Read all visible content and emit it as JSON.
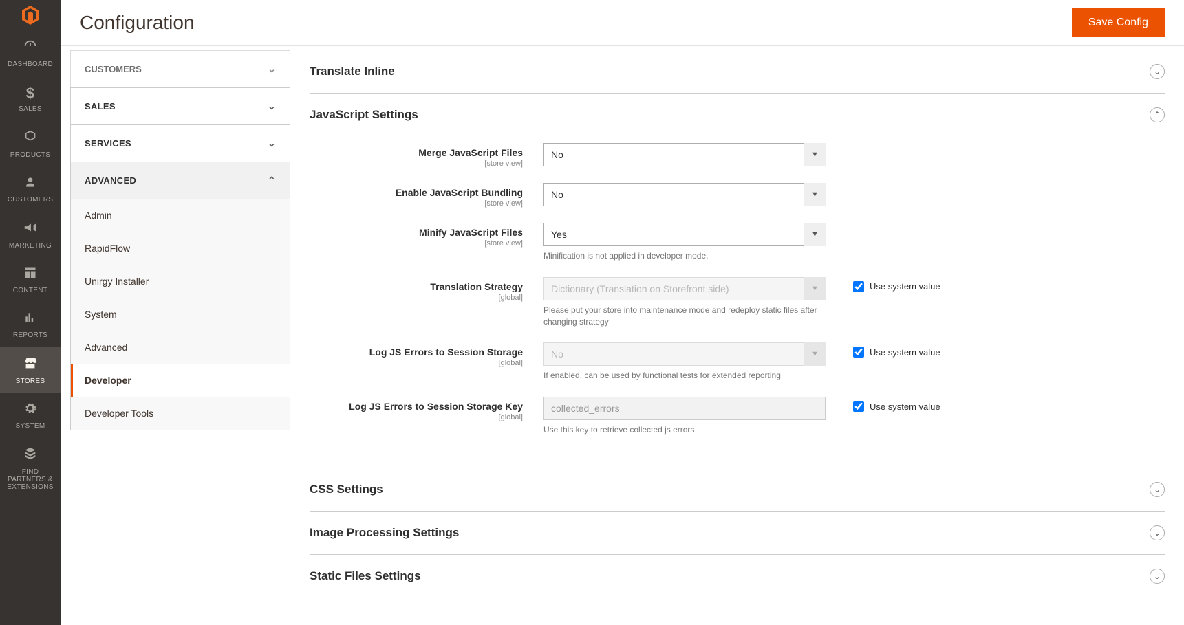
{
  "header": {
    "title": "Configuration",
    "save_label": "Save Config"
  },
  "nav": {
    "items": [
      {
        "icon": "dashboard",
        "label": "DASHBOARD"
      },
      {
        "icon": "sales",
        "label": "SALES"
      },
      {
        "icon": "products",
        "label": "PRODUCTS"
      },
      {
        "icon": "customers",
        "label": "CUSTOMERS"
      },
      {
        "icon": "marketing",
        "label": "MARKETING"
      },
      {
        "icon": "content",
        "label": "CONTENT"
      },
      {
        "icon": "reports",
        "label": "REPORTS"
      },
      {
        "icon": "stores",
        "label": "STORES"
      },
      {
        "icon": "system",
        "label": "SYSTEM"
      },
      {
        "icon": "partners",
        "label": "FIND PARTNERS & EXTENSIONS"
      }
    ],
    "active_index": 7
  },
  "config_tabs": {
    "truncated_top": "CUSTOMERS",
    "sections": [
      {
        "label": "SALES",
        "expanded": false
      },
      {
        "label": "SERVICES",
        "expanded": false
      },
      {
        "label": "ADVANCED",
        "expanded": true,
        "items": [
          {
            "label": "Admin"
          },
          {
            "label": "RapidFlow"
          },
          {
            "label": "Unirgy Installer"
          },
          {
            "label": "System"
          },
          {
            "label": "Advanced"
          },
          {
            "label": "Developer",
            "active": true
          },
          {
            "label": "Developer Tools"
          }
        ]
      }
    ]
  },
  "fieldsets": [
    {
      "title": "Translate Inline",
      "expanded": false
    },
    {
      "title": "JavaScript Settings",
      "expanded": true,
      "fields": [
        {
          "label": "Merge JavaScript Files",
          "scope": "[store view]",
          "type": "select",
          "value": "No",
          "disabled": false
        },
        {
          "label": "Enable JavaScript Bundling",
          "scope": "[store view]",
          "type": "select",
          "value": "No",
          "disabled": false
        },
        {
          "label": "Minify JavaScript Files",
          "scope": "[store view]",
          "type": "select",
          "value": "Yes",
          "disabled": false,
          "note": "Minification is not applied in developer mode."
        },
        {
          "label": "Translation Strategy",
          "scope": "[global]",
          "type": "select",
          "value": "Dictionary (Translation on Storefront side)",
          "disabled": true,
          "note": "Please put your store into maintenance mode and redeploy static files after changing strategy",
          "use_system": true,
          "use_system_label": "Use system value"
        },
        {
          "label": "Log JS Errors to Session Storage",
          "scope": "[global]",
          "type": "select",
          "value": "No",
          "disabled": true,
          "note": "If enabled, can be used by functional tests for extended reporting",
          "use_system": true,
          "use_system_label": "Use system value"
        },
        {
          "label": "Log JS Errors to Session Storage Key",
          "scope": "[global]",
          "type": "text",
          "value": "collected_errors",
          "disabled": true,
          "note": "Use this key to retrieve collected js errors",
          "use_system": true,
          "use_system_label": "Use system value"
        }
      ]
    },
    {
      "title": "CSS Settings",
      "expanded": false
    },
    {
      "title": "Image Processing Settings",
      "expanded": false
    },
    {
      "title": "Static Files Settings",
      "expanded": false
    }
  ],
  "icons": {
    "chevron_down": "⌄",
    "chevron_up": "⌃"
  }
}
